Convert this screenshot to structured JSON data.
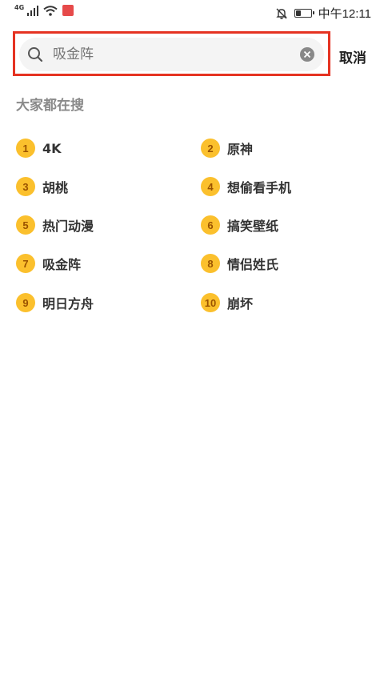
{
  "status_bar": {
    "network": "4G",
    "time": "中午12:11",
    "battery_level": 0.4
  },
  "search": {
    "placeholder": "吸金阵",
    "cancel_label": "取消",
    "highlight_color": "#e53322"
  },
  "trending": {
    "title": "大家都在搜",
    "badge_color": "#fbc02d",
    "items": [
      {
        "rank": "1",
        "label": "4K"
      },
      {
        "rank": "2",
        "label": "原神"
      },
      {
        "rank": "3",
        "label": "胡桃"
      },
      {
        "rank": "4",
        "label": "想偷看手机"
      },
      {
        "rank": "5",
        "label": "热门动漫"
      },
      {
        "rank": "6",
        "label": "搞笑壁纸"
      },
      {
        "rank": "7",
        "label": "吸金阵"
      },
      {
        "rank": "8",
        "label": "情侣姓氏"
      },
      {
        "rank": "9",
        "label": "明日方舟"
      },
      {
        "rank": "10",
        "label": "崩坏"
      }
    ]
  }
}
